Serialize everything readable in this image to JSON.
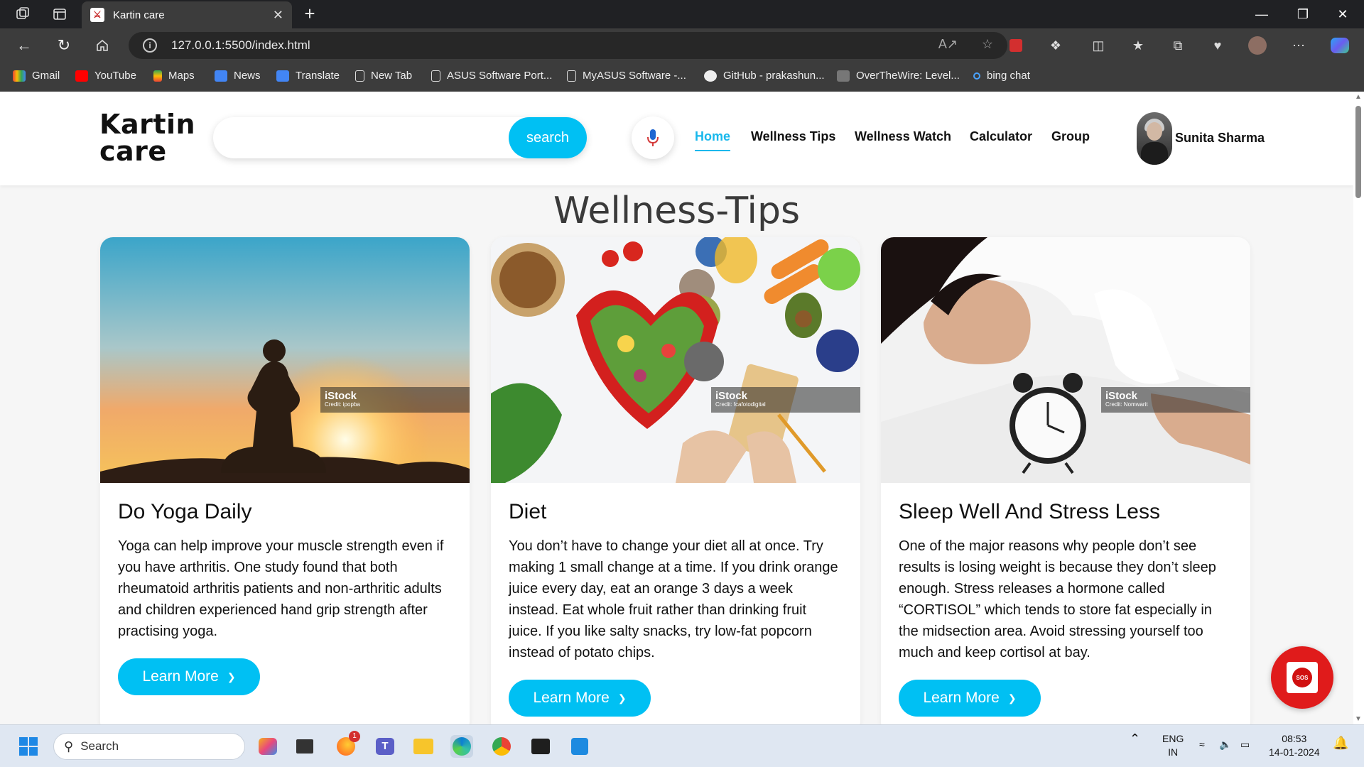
{
  "browser": {
    "tab_title": "Kartin care",
    "url": "127.0.0.1:5500/index.html",
    "bookmarks": [
      "Gmail",
      "YouTube",
      "Maps",
      "News",
      "Translate",
      "New Tab",
      "ASUS Software Port...",
      "MyASUS Software -...",
      "GitHub - prakashun...",
      "OverTheWire: Level...",
      "bing chat"
    ]
  },
  "site": {
    "logo_line1": "Kartin",
    "logo_line2": "care",
    "search_placeholder": "",
    "search_button": "search",
    "nav": [
      "Home",
      "Wellness Tips",
      "Wellness Watch",
      "Calculator",
      "Group"
    ],
    "user_name": "Sunita Sharma"
  },
  "section_title": "Wellness-Tips",
  "cards": [
    {
      "title": "Do Yoga Daily",
      "text": "Yoga can help improve your muscle strength even if you have arthritis. One study found that both rheumatoid arthritis patients and non-arthritic adults and children experienced hand grip strength after practising yoga.",
      "button": "Learn More",
      "watermark": "iStock",
      "credit": "Credit: ipopba"
    },
    {
      "title": "Diet",
      "text": "You don’t have to change your diet all at once. Try making 1 small change at a time. If you drink orange juice every day, eat an orange 3 days a week instead. Eat whole fruit rather than drinking fruit juice. If you like salty snacks, try low-fat popcorn instead of potato chips.",
      "button": "Learn More",
      "watermark": "iStock",
      "credit": "Credit: fcafotodigital"
    },
    {
      "title": "Sleep Well And Stress Less",
      "text": "One of the major reasons why people don’t see results is losing weight is because they don’t sleep enough. Stress releases a hormone called “CORTISOL” which tends to store fat especially in the midsection area. Avoid stressing yourself too much and keep cortisol at bay.",
      "button": "Learn More",
      "watermark": "iStock",
      "credit": "Credit: Nomwarit"
    }
  ],
  "sos_label": "SOS",
  "taskbar": {
    "search_label": "Search",
    "lang_line1": "ENG",
    "lang_line2": "IN",
    "time": "08:53",
    "date": "14-01-2024",
    "badge": "1"
  },
  "colors": {
    "accent": "#00c0f3",
    "sos": "#e01b1b"
  }
}
